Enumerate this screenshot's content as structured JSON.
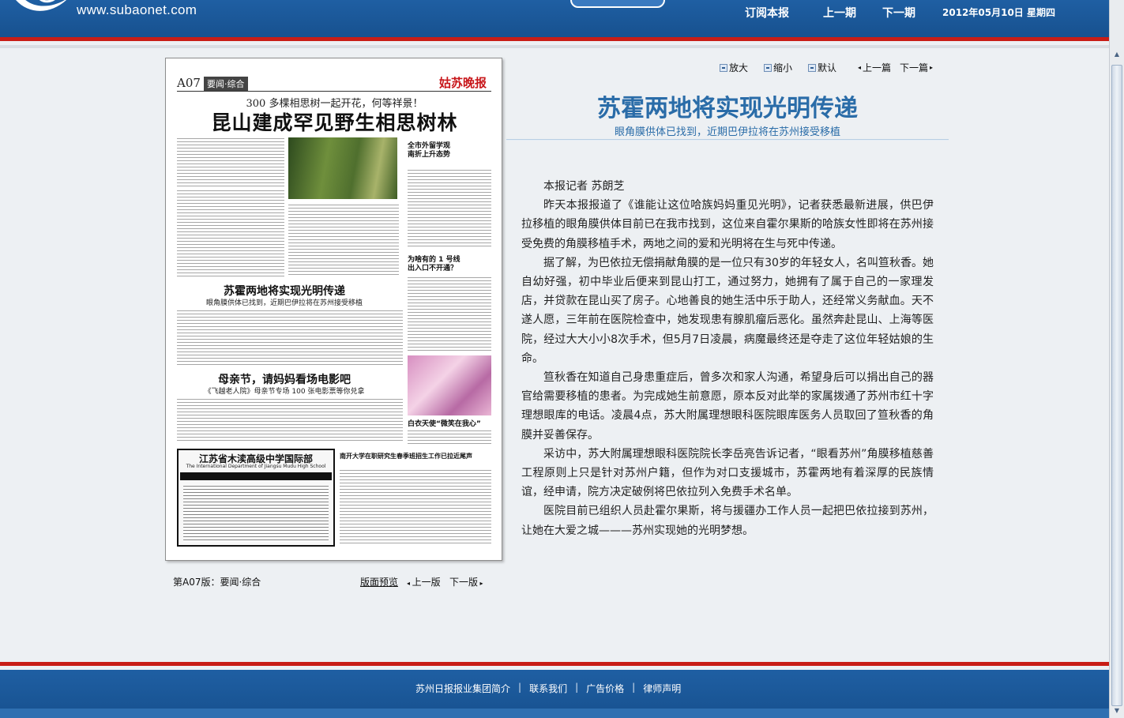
{
  "header": {
    "site_url": "www.subaonet.com",
    "nav": [
      "订阅本报",
      "上一期",
      "下一期"
    ],
    "date": "2012年05月10日  星期四"
  },
  "paper": {
    "page_no": "A07",
    "section": "要闻·综合",
    "masthead": "姑苏晚报",
    "kicker": "300 多棵相思树一起开花，何等祥景！",
    "headline": "昆山建成罕见野生相思树林",
    "side_title_1": "全市外留学观\n南折上升态势",
    "side_title_2": "为啥有的 1 号线\n出入口不开通？",
    "story2_head": "苏霍两地将实现光明传递",
    "story2_sub": "眼角膜供体已找到，近期巴伊拉将在苏州接受移植",
    "story3_head": "母亲节，请妈妈看场电影吧",
    "story3_sub": "《飞越老人院》母亲节专场 100 张电影票等你兑拿",
    "photo2_caption": "白衣天使“微笑在我心”",
    "ad_title": "江苏省木渎高级中学国际部",
    "ad_sub": "The International Department of Jiangsu Mudu High School",
    "ad_right_head": "南开大学在职研究生春季班招生工作已拉近尾声",
    "caption": "第A07版：要闻·综合",
    "preview": "版面预览",
    "prev": "上一版",
    "next": "下一版"
  },
  "tools": {
    "zoom_in": "放大",
    "zoom_out": "缩小",
    "default": "默认",
    "prev_article": "上一篇",
    "next_article": "下一篇"
  },
  "article": {
    "title": "苏霍两地将实现光明传递",
    "subtitle": "眼角膜供体已找到，近期巴伊拉将在苏州接受移植",
    "byline": "本报记者    苏朗芝",
    "paragraphs": [
      "昨天本报报道了《谁能让这位哈族妈妈重见光明》，记者获悉最新进展，供巴伊拉移植的眼角膜供体目前已在我市找到，这位来自霍尔果斯的哈族女性即将在苏州接受免费的角膜移植手术，两地之间的爱和光明将在生与死中传递。",
      "据了解，为巴依拉无偿捐献角膜的是一位只有30岁的年轻女人，名叫笪秋香。她自幼好强，初中毕业后便来到昆山打工，通过努力，她拥有了属于自己的一家理发店，并贷款在昆山买了房子。心地善良的她生活中乐于助人，还经常义务献血。天不遂人愿，三年前在医院检查中，她发现患有腺肌瘤后恶化。虽然奔赴昆山、上海等医院，经过大大小小8次手术，但5月7日凌晨，病魔最终还是夺走了这位年轻姑娘的生命。",
      "笪秋香在知道自己身患重症后，曾多次和家人沟通，希望身后可以捐出自己的器官给需要移植的患者。为完成她生前意愿，原本反对此举的家属拨通了苏州市红十字理想眼库的电话。凌晨4点，苏大附属理想眼科医院眼库医务人员取回了笪秋香的角膜并妥善保存。",
      "采访中，苏大附属理想眼科医院院长李岳亮告诉记者，“眼看苏州”角膜移植慈善工程原则上只是针对苏州户籍，但作为对口支援城市，苏霍两地有着深厚的民族情谊，经申请，院方决定破例将巴依拉列入免费手术名单。",
      "医院目前已组织人员赴霍尔果斯，将与援疆办工作人员一起把巴依拉接到苏州，让她在大爱之城———苏州实现她的光明梦想。"
    ]
  },
  "footer": {
    "links": [
      "苏州日报报业集团简介",
      "联系我们",
      "广告价格",
      "律师声明"
    ],
    "separator": "|"
  }
}
